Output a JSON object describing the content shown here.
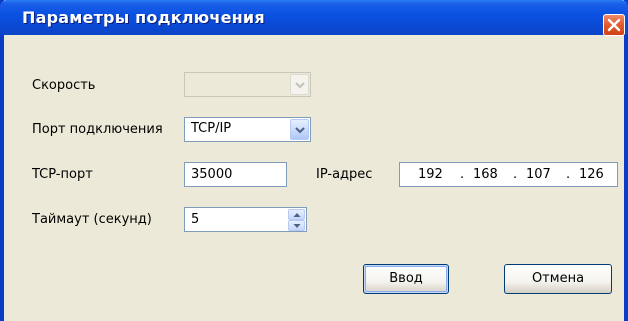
{
  "window": {
    "title": "Параметры подключения"
  },
  "fields": {
    "speed": {
      "label": "Скорость",
      "value": "",
      "disabled": true
    },
    "port": {
      "label": "Порт подключения",
      "value": "TCP/IP"
    },
    "tcp_port": {
      "label": "TCP-порт",
      "value": "35000"
    },
    "ip_address": {
      "label": "IP-адрес",
      "octets": [
        "192",
        "168",
        "107",
        "126"
      ],
      "separator": "."
    },
    "timeout": {
      "label": "Таймаут (секунд)",
      "value": "5"
    }
  },
  "buttons": {
    "ok_label": "Ввод",
    "cancel_label": "Отмена"
  },
  "icons": {
    "close": "close-icon",
    "dropdown": "chevron-down-icon",
    "spin_up": "arrow-up-icon",
    "spin_down": "arrow-down-icon"
  },
  "colors": {
    "titlebar": "#0b52e2",
    "window_bg": "#ece9d8",
    "close_button": "#e25a2c",
    "field_border": "#7f9db9"
  }
}
